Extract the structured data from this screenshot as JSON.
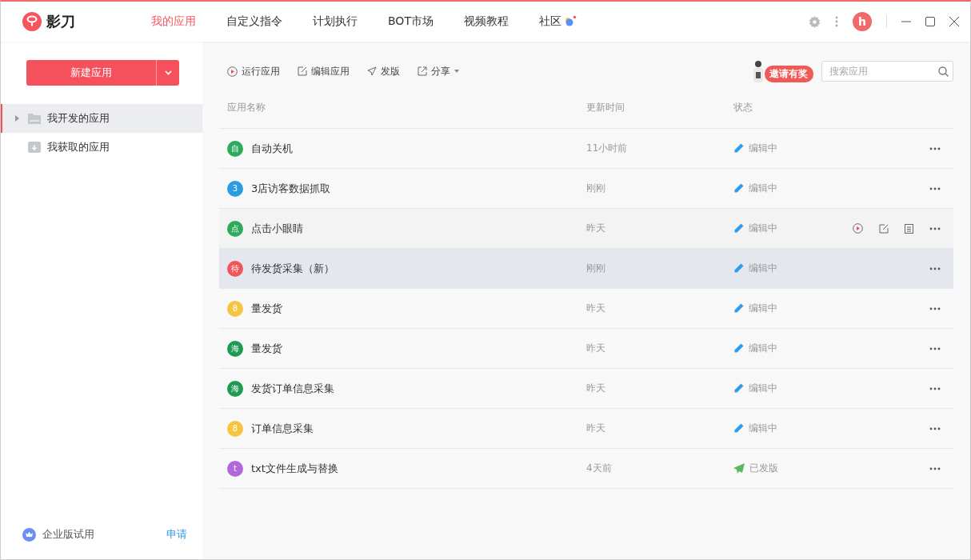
{
  "app": {
    "name": "影刀"
  },
  "nav": [
    {
      "label": "我的应用",
      "selected": true
    },
    {
      "label": "自定义指令",
      "selected": false
    },
    {
      "label": "计划执行",
      "selected": false
    },
    {
      "label": "BOT市场",
      "selected": false
    },
    {
      "label": "视频教程",
      "selected": false
    },
    {
      "label": "社区",
      "selected": false
    }
  ],
  "user": {
    "initial": "h"
  },
  "sidebar": {
    "new_button": "新建应用",
    "items": [
      {
        "label": "我开发的应用",
        "selected": true,
        "kind": "folder"
      },
      {
        "label": "我获取的应用",
        "selected": false,
        "kind": "download"
      }
    ],
    "footer": {
      "label": "企业版试用",
      "link": "申请"
    }
  },
  "toolbar": {
    "actions": [
      {
        "label": "运行应用",
        "kind": "run"
      },
      {
        "label": "编辑应用",
        "kind": "edit"
      },
      {
        "label": "发版",
        "kind": "publish"
      },
      {
        "label": "分享",
        "kind": "share"
      }
    ],
    "invite": "邀请有奖",
    "search": {
      "placeholder": "搜索应用"
    }
  },
  "table": {
    "columns": [
      "应用名称",
      "更新时间",
      "状态"
    ],
    "rows": [
      {
        "initial": "自",
        "color": "#2eaa5c",
        "name": "自动关机",
        "time": "11小时前",
        "status": "编辑中",
        "kind": "editing",
        "hovered": false,
        "selected": false
      },
      {
        "initial": "3",
        "color": "#2d9be0",
        "name": "3店访客数据抓取",
        "time": "刚刚",
        "status": "编辑中",
        "kind": "editing",
        "hovered": false,
        "selected": false
      },
      {
        "initial": "点",
        "color": "#2eaa5c",
        "name": "点击小眼睛",
        "time": "昨天",
        "status": "编辑中",
        "kind": "editing",
        "hovered": true,
        "selected": false
      },
      {
        "initial": "待",
        "color": "#f25757",
        "name": "待发货采集（新）",
        "time": "刚刚",
        "status": "编辑中",
        "kind": "editing",
        "hovered": false,
        "selected": true
      },
      {
        "initial": "8",
        "color": "#f5c542",
        "name": "量发货",
        "time": "昨天",
        "status": "编辑中",
        "kind": "editing",
        "hovered": false,
        "selected": false
      },
      {
        "initial": "海",
        "color": "#1f9a50",
        "name": "量发货",
        "time": "昨天",
        "status": "编辑中",
        "kind": "editing",
        "hovered": false,
        "selected": false
      },
      {
        "initial": "海",
        "color": "#1f9a50",
        "name": "发货订单信息采集",
        "time": "昨天",
        "status": "编辑中",
        "kind": "editing",
        "hovered": false,
        "selected": false
      },
      {
        "initial": "8",
        "color": "#f5c542",
        "name": "订单信息采集",
        "time": "昨天",
        "status": "编辑中",
        "kind": "editing",
        "hovered": false,
        "selected": false
      },
      {
        "initial": "t",
        "color": "#b368d9",
        "name": "txt文件生成与替换",
        "time": "4天前",
        "status": "已发版",
        "kind": "released",
        "hovered": false,
        "selected": false
      }
    ]
  }
}
